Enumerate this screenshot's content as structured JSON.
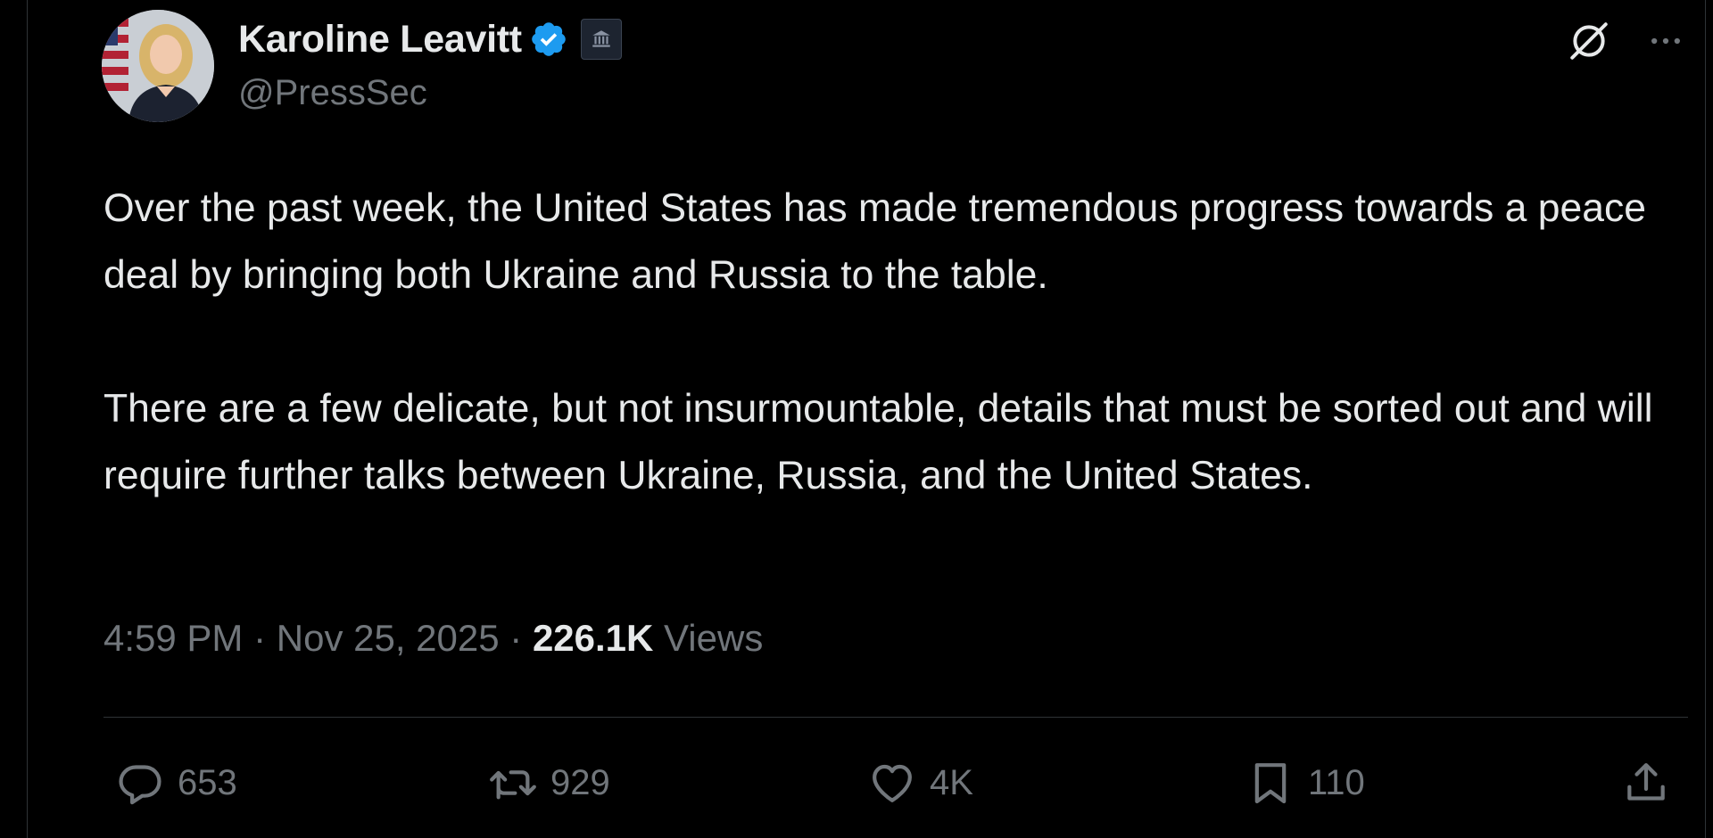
{
  "author": {
    "name": "Karoline Leavitt",
    "handle": "@PressSec"
  },
  "icons": {
    "verified": "verified-badge-icon",
    "affiliation": "government-building-icon",
    "grok": "grok-icon",
    "more": "more-options-icon",
    "reply": "reply-icon",
    "retweet": "retweet-icon",
    "like": "heart-icon",
    "bookmark": "bookmark-icon",
    "share": "share-icon"
  },
  "tweet": {
    "paragraphs": [
      "Over the past week, the United States has made tremendous progress towards a peace deal by bringing both Ukraine and Russia to the table.",
      "There are a few delicate, but not insurmountable, details that must be sorted out and will require further talks between Ukraine, Russia, and the United States."
    ],
    "time": "4:59 PM",
    "separator": " · ",
    "date": "Nov 25, 2025",
    "views_count": "226.1K",
    "views_label": "Views"
  },
  "stats": {
    "replies": "653",
    "retweets": "929",
    "likes": "4K",
    "bookmarks": "110"
  },
  "colors": {
    "background": "#000000",
    "text_primary": "#e7e9ea",
    "text_secondary": "#71767b",
    "verified": "#1d9bf0",
    "divider": "#2f3336"
  }
}
